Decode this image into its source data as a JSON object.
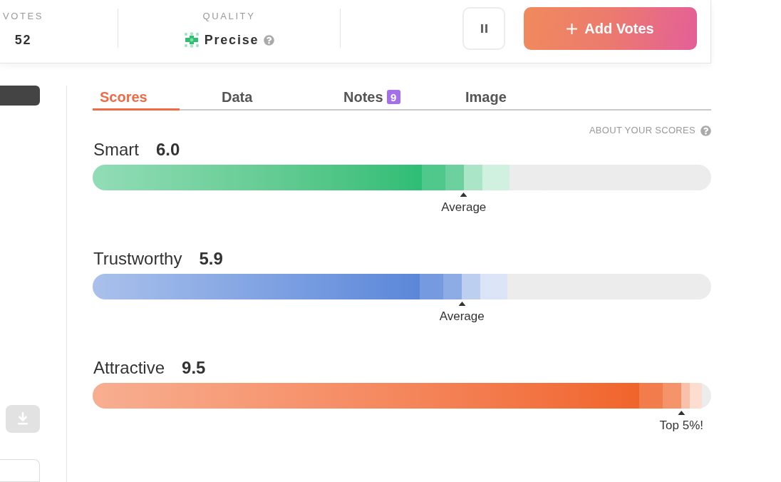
{
  "header": {
    "stats": [
      {
        "kind": "plain",
        "label": "VOTES",
        "value": "52"
      },
      {
        "kind": "quality",
        "label": "QUALITY",
        "value": "Precise"
      }
    ],
    "add_button": {
      "label": "Add Votes"
    }
  },
  "tabs": [
    {
      "label": "Scores",
      "selected": true
    },
    {
      "label": "Data",
      "selected": false
    },
    {
      "label": "Notes",
      "selected": false,
      "badge": "9"
    },
    {
      "label": "Image",
      "selected": false
    }
  ],
  "about_link": "ABOUT YOUR SCORES",
  "scores": [
    {
      "name": "Smart",
      "value": "6.0",
      "level": 0.6,
      "color": "#2dbd74",
      "marker": "Average"
    },
    {
      "name": "Trustworthy",
      "value": "5.9",
      "level": 0.597,
      "color": "#5b87d9",
      "marker": "Average"
    },
    {
      "name": "Attractive",
      "value": "9.5",
      "level": 0.952,
      "color": "#f0642a",
      "marker": "Top 5%!"
    }
  ]
}
